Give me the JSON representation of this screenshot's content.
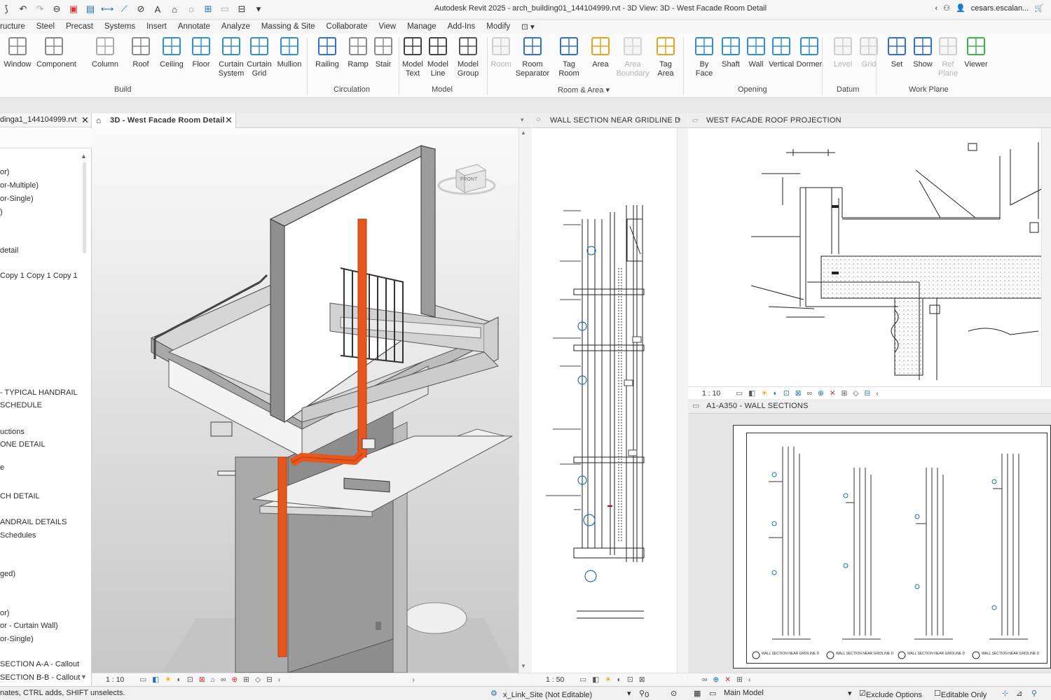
{
  "app": {
    "title": "Autodesk Revit 2025 - arch_building01_144104999.rvt - 3D View: 3D - West Facade Room Detail",
    "user": "cesars.escalan...",
    "accent": "#1f6fb5",
    "pipe_color": "#e8551d"
  },
  "quick_access": [
    "app-menu-icon",
    "undo-icon",
    "redo-icon",
    "sync-icon",
    "save-icon",
    "print-icon",
    "measure-icon",
    "tag-icon",
    "text-icon",
    "home-icon",
    "visibility-icon",
    "switch-window-icon",
    "close-hidden-icon",
    "views-icon",
    "dropdown-icon"
  ],
  "menu_tabs": [
    "ructure",
    "Steel",
    "Precast",
    "Systems",
    "Insert",
    "Annotate",
    "Analyze",
    "Massing & Site",
    "Collaborate",
    "View",
    "Manage",
    "Add-Ins",
    "Modify"
  ],
  "ribbon": {
    "buttons": [
      {
        "label": "Window",
        "label2": "",
        "icon": "window-icon",
        "enabled": true
      },
      {
        "label": "Component",
        "label2": "",
        "icon": "component-icon",
        "enabled": true
      },
      {
        "label": "Column",
        "label2": "",
        "icon": "column-icon",
        "enabled": true
      },
      {
        "label": "Roof",
        "label2": "",
        "icon": "roof-icon",
        "enabled": true
      },
      {
        "label": "Ceiling",
        "label2": "",
        "icon": "ceiling-icon",
        "enabled": true
      },
      {
        "label": "Floor",
        "label2": "",
        "icon": "floor-icon",
        "enabled": true
      },
      {
        "label": "Curtain",
        "label2": "System",
        "icon": "curtain-system-icon",
        "enabled": true
      },
      {
        "label": "Curtain",
        "label2": "Grid",
        "icon": "curtain-grid-icon",
        "enabled": true
      },
      {
        "label": "Mullion",
        "label2": "",
        "icon": "mullion-icon",
        "enabled": true
      },
      {
        "label": "Railing",
        "label2": "",
        "icon": "railing-icon",
        "enabled": true
      },
      {
        "label": "Ramp",
        "label2": "",
        "icon": "ramp-icon",
        "enabled": true
      },
      {
        "label": "Stair",
        "label2": "",
        "icon": "stair-icon",
        "enabled": true
      },
      {
        "label": "Model",
        "label2": "Text",
        "icon": "model-text-icon",
        "enabled": true
      },
      {
        "label": "Model",
        "label2": "Line",
        "icon": "model-line-icon",
        "enabled": true
      },
      {
        "label": "Model",
        "label2": "Group",
        "icon": "model-group-icon",
        "enabled": true
      },
      {
        "label": "Room",
        "label2": "",
        "icon": "room-icon",
        "enabled": false
      },
      {
        "label": "Room",
        "label2": "Separator",
        "icon": "room-separator-icon",
        "enabled": true
      },
      {
        "label": "Tag",
        "label2": "Room",
        "icon": "tag-room-icon",
        "enabled": true
      },
      {
        "label": "Area",
        "label2": "",
        "icon": "area-icon",
        "enabled": true
      },
      {
        "label": "Area",
        "label2": "Boundary",
        "icon": "area-boundary-icon",
        "enabled": false
      },
      {
        "label": "Tag",
        "label2": "Area",
        "icon": "tag-area-icon",
        "enabled": true
      },
      {
        "label": "By",
        "label2": "Face",
        "icon": "by-face-icon",
        "enabled": true
      },
      {
        "label": "Shaft",
        "label2": "",
        "icon": "shaft-icon",
        "enabled": true
      },
      {
        "label": "Wall",
        "label2": "",
        "icon": "wall-opening-icon",
        "enabled": true
      },
      {
        "label": "Vertical",
        "label2": "",
        "icon": "vertical-icon",
        "enabled": true
      },
      {
        "label": "Dormer",
        "label2": "",
        "icon": "dormer-icon",
        "enabled": true
      },
      {
        "label": "Level",
        "label2": "",
        "icon": "level-icon",
        "enabled": false
      },
      {
        "label": "Grid",
        "label2": "",
        "icon": "grid-icon",
        "enabled": false
      },
      {
        "label": "Set",
        "label2": "",
        "icon": "set-icon",
        "enabled": true
      },
      {
        "label": "Show",
        "label2": "",
        "icon": "show-icon",
        "enabled": true
      },
      {
        "label": "Ref",
        "label2": "Plane",
        "icon": "ref-plane-icon",
        "enabled": false
      },
      {
        "label": "Viewer",
        "label2": "",
        "icon": "viewer-icon",
        "enabled": true
      }
    ],
    "panels": [
      "Build",
      "Circulation",
      "Model",
      "Room & Area",
      "Opening",
      "Datum",
      "Work Plane"
    ]
  },
  "browser": {
    "header": "dinga1_144104999.rvt",
    "items": [
      "or)",
      "or-Multiple)",
      "or-Single)",
      ")",
      "detail",
      "Copy 1 Copy 1 Copy 1",
      "- TYPICAL HANDRAIL",
      "SCHEDULE",
      "uctions",
      "ONE DETAIL",
      "e",
      "CH DETAIL",
      "ANDRAIL DETAILS",
      "Schedules",
      "ged)",
      "or)",
      "or - Curtain Wall)",
      "or-Single)",
      "SECTION A-A - Callout",
      "SECTION B-B - Callout"
    ]
  },
  "views": {
    "main_tab": "3D - West Facade Room Detail",
    "viewcube_label": "FRONT",
    "scale_main": "1 : 10",
    "wall_section_title": "WALL SECTION NEAR GRIDLINE D",
    "scale_wall": "1 : 50",
    "roof_title": "WEST FACADE ROOF PROJECTION",
    "scale_roof": "1 : 10",
    "sheet_title": "A1-A350 - WALL SECTIONS",
    "sheet_labels": [
      "WALL SECTION NEAR GRIDLINE D",
      "WALL SECTION NEAR GRIDLINE D",
      "WALL SECTION NEAR GRIDLINE D",
      "WALL SECTION NEAR GRIDLINE D"
    ]
  },
  "status": {
    "hint": "nates, CTRL adds, SHIFT unselects.",
    "workset": "x_Link_Site (Not Editable)",
    "count": "0",
    "model": "Main Model",
    "exclude": "Exclude Options",
    "editable": "Editable Only"
  }
}
